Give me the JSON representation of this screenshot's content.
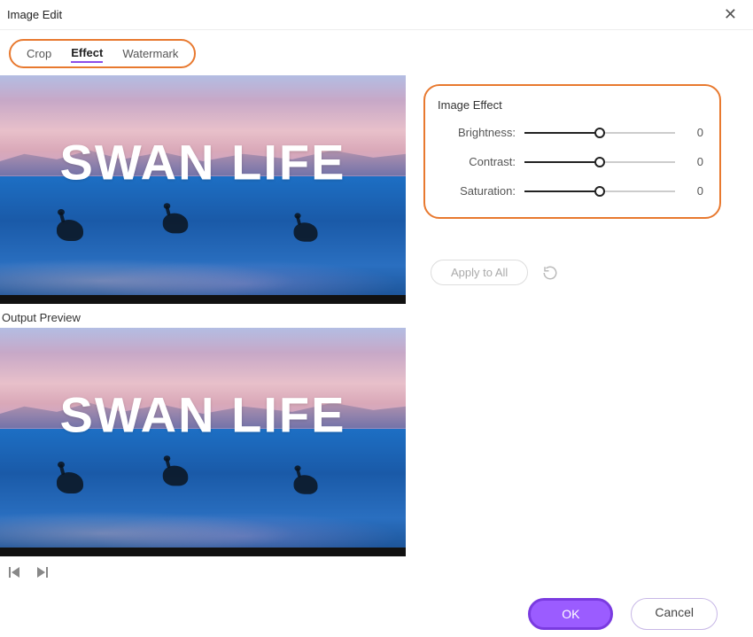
{
  "window": {
    "title": "Image Edit"
  },
  "tabs": {
    "crop": "Crop",
    "effect": "Effect",
    "watermark": "Watermark"
  },
  "preview": {
    "headline": "SWAN LIFE",
    "output_label": "Output Preview"
  },
  "effect_panel": {
    "title": "Image Effect",
    "brightness": {
      "label": "Brightness:",
      "value": "0"
    },
    "contrast": {
      "label": "Contrast:",
      "value": "0"
    },
    "saturation": {
      "label": "Saturation:",
      "value": "0"
    }
  },
  "actions": {
    "apply_all": "Apply to All",
    "ok": "OK",
    "cancel": "Cancel"
  }
}
